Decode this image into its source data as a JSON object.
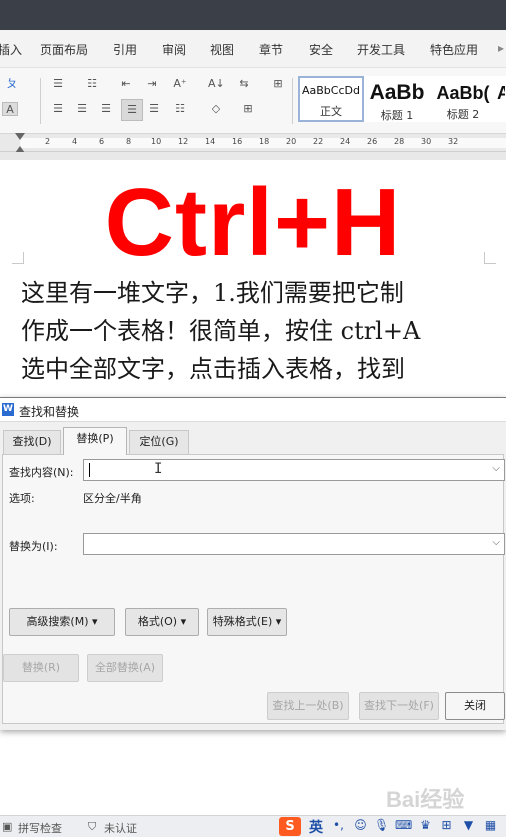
{
  "menu": {
    "items": [
      "插入",
      "页面布局",
      "引用",
      "审阅",
      "视图",
      "章节",
      "安全",
      "开发工具",
      "特色应用"
    ]
  },
  "ribbon": {
    "styles": [
      {
        "sample": "AaBbCcDd",
        "name": "正文"
      },
      {
        "sample": "AaBb",
        "name": "标题 1"
      },
      {
        "sample": "AaBb(",
        "name": "标题 2"
      },
      {
        "sample": "A",
        "name": ""
      }
    ]
  },
  "ruler": {
    "numbers": [
      "2",
      "4",
      "6",
      "8",
      "10",
      "12",
      "14",
      "16",
      "18",
      "20",
      "22",
      "24",
      "26",
      "28",
      "30",
      "32"
    ]
  },
  "document": {
    "headline": "Ctrl+H",
    "lines": [
      "这里有一堆文字，1.我们需要把它制",
      "作成一个表格！很简单，按住 ctrl+A",
      "选中全部文字，点击插入表格，找到"
    ]
  },
  "dialog": {
    "title": "查找和替换",
    "tabs": [
      {
        "label": "查找(D)",
        "active": false
      },
      {
        "label": "替换(P)",
        "active": true
      },
      {
        "label": "定位(G)",
        "active": false
      }
    ],
    "find_label": "查找内容(N):",
    "find_value": "",
    "options_label": "选项:",
    "options_value": "区分全/半角",
    "replace_label": "替换为(I):",
    "replace_value": "",
    "buttons": {
      "advanced": "高级搜索(M)",
      "format": "格式(O)",
      "special": "特殊格式(E)",
      "replace": "替换(R)",
      "replace_all": "全部替换(A)",
      "find_prev": "查找上一处(B)",
      "find_next": "查找下一处(F)",
      "close": "关闭"
    }
  },
  "statusbar": {
    "spell_check": "拼写检查",
    "auth": "未认证",
    "ime_logo": "S",
    "ime_mode": "英"
  },
  "watermark": "Bai经验"
}
